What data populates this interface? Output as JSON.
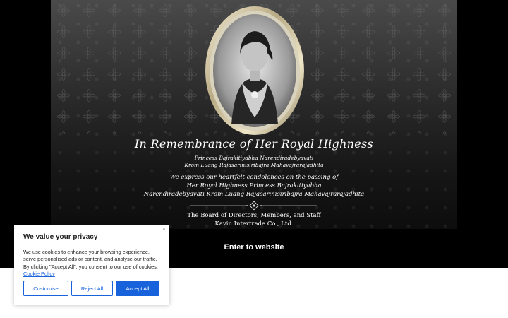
{
  "memorial": {
    "title": "In Remembrance of Her Royal Highness",
    "name_line1": "Princess Bajrakitiyabha Narendiradebyavati",
    "name_line2": "Krom Luang Rajasarinisiribajra Mahavajrarajadhita",
    "message_line1": "We express our heartfelt condolences on the passing of",
    "message_line2": "Her Royal Highness Princess Bajrakitiyabha",
    "message_line3": "Narendiradebyavati Krom Luang Rajasarinisiribajra Mahavajrarajadhita",
    "board_line1": "The Board of Directors, Members, and Staff",
    "board_line2": "Kavin Intertrade Co., Ltd."
  },
  "enter_link": "Enter to website",
  "cookie_banner": {
    "title": "We value your privacy",
    "body": "We use cookies to enhance your browsing experience, serve personalised ads or content, and analyse our traffic. By clicking \"Accept All\", you consent to our use of cookies.",
    "policy_link": "Cookie Policy",
    "close_icon": "×",
    "customise_label": "Customise",
    "reject_label": "Reject All",
    "accept_label": "Accept All"
  },
  "colors": {
    "accent": "#1863dc",
    "band": "#000000"
  }
}
